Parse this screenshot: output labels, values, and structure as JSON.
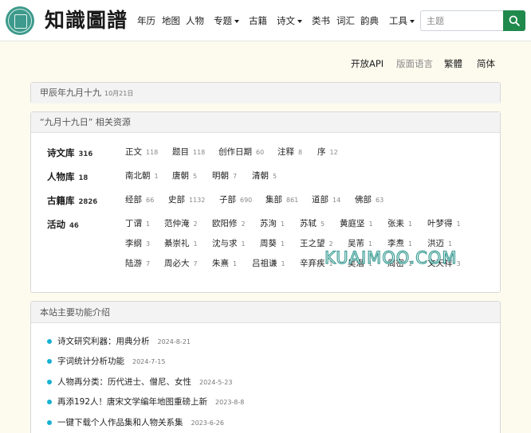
{
  "brand": {
    "title": "知識圖譜"
  },
  "nav": {
    "items": [
      {
        "label": "年历"
      },
      {
        "label": "地图"
      },
      {
        "label": "人物"
      },
      {
        "label": "专题"
      },
      {
        "label": "古籍"
      },
      {
        "label": "诗文"
      },
      {
        "label": "类书"
      },
      {
        "label": "词汇"
      },
      {
        "label": "韵典"
      },
      {
        "label": "工具"
      }
    ],
    "search_placeholder": "主题",
    "search_button_color": "#1f8a4c"
  },
  "lang": {
    "items": [
      {
        "label": "开放API",
        "active": true
      },
      {
        "label": "版面语言",
        "active": false
      },
      {
        "label": "繁體",
        "active": true
      },
      {
        "label": "简体",
        "active": true
      }
    ]
  },
  "date_card": {
    "lunar": "甲辰年九月十九",
    "solar": "10月21日"
  },
  "resources": {
    "header": "“九月十九日” 相关资源",
    "categories": [
      {
        "label": "诗文库",
        "count": "316",
        "items": [
          {
            "name": "正文",
            "count": "118"
          },
          {
            "name": "题目",
            "count": "118"
          },
          {
            "name": "创作日期",
            "count": "60"
          },
          {
            "name": "注释",
            "count": "8"
          },
          {
            "name": "序",
            "count": "12"
          }
        ]
      },
      {
        "label": "人物库",
        "count": "18",
        "items": [
          {
            "name": "南北朝",
            "count": "1"
          },
          {
            "name": "唐朝",
            "count": "5"
          },
          {
            "name": "明朝",
            "count": "7"
          },
          {
            "name": "清朝",
            "count": "5"
          }
        ]
      },
      {
        "label": "古籍库",
        "count": "2826",
        "items": [
          {
            "name": "经部",
            "count": "66"
          },
          {
            "name": "史部",
            "count": "1132"
          },
          {
            "name": "子部",
            "count": "690"
          },
          {
            "name": "集部",
            "count": "861"
          },
          {
            "name": "道部",
            "count": "14"
          },
          {
            "name": "佛部",
            "count": "63"
          }
        ]
      },
      {
        "label": "活动",
        "count": "46",
        "items": [
          {
            "name": "丁谓",
            "count": "1"
          },
          {
            "name": "范仲淹",
            "count": "2"
          },
          {
            "name": "欧阳修",
            "count": "2"
          },
          {
            "name": "苏洵",
            "count": "1"
          },
          {
            "name": "苏轼",
            "count": "5"
          },
          {
            "name": "黄庭坚",
            "count": "1"
          },
          {
            "name": "张耒",
            "count": "1"
          },
          {
            "name": "叶梦得",
            "count": "1"
          },
          {
            "name": "李纲",
            "count": "3"
          },
          {
            "name": "綦崇礼",
            "count": "1"
          },
          {
            "name": "沈与求",
            "count": "1"
          },
          {
            "name": "周葵",
            "count": "1"
          },
          {
            "name": "王之望",
            "count": "2"
          },
          {
            "name": "吴芾",
            "count": "1"
          },
          {
            "name": "李焘",
            "count": "1"
          },
          {
            "name": "洪迈",
            "count": "1"
          },
          {
            "name": "陆游",
            "count": "7"
          },
          {
            "name": "周必大",
            "count": "7"
          },
          {
            "name": "朱熹",
            "count": "1"
          },
          {
            "name": "吕祖谦",
            "count": "1"
          },
          {
            "name": "辛弃疾",
            "count": "1"
          },
          {
            "name": "吴潜",
            "count": "1"
          },
          {
            "name": "周密",
            "count": "1"
          },
          {
            "name": "文天祥",
            "count": "3"
          }
        ]
      }
    ]
  },
  "watermark": "KUAIMOO.COM",
  "intro": {
    "header": "本站主要功能介绍",
    "bullet_color": "#17b0d3",
    "news": [
      {
        "title": "诗文研究利器：用典分析",
        "date": "2024-8-21"
      },
      {
        "title": "字词统计分析功能",
        "date": "2024-7-15"
      },
      {
        "title": "人物再分类：历代进士、僧尼、女性",
        "date": "2024-5-23"
      },
      {
        "title": "再添192人！唐宋文学编年地图重磅上新",
        "date": "2023-8-8"
      },
      {
        "title": "一键下载个人作品集和人物关系集",
        "date": "2023-6-26"
      }
    ]
  }
}
